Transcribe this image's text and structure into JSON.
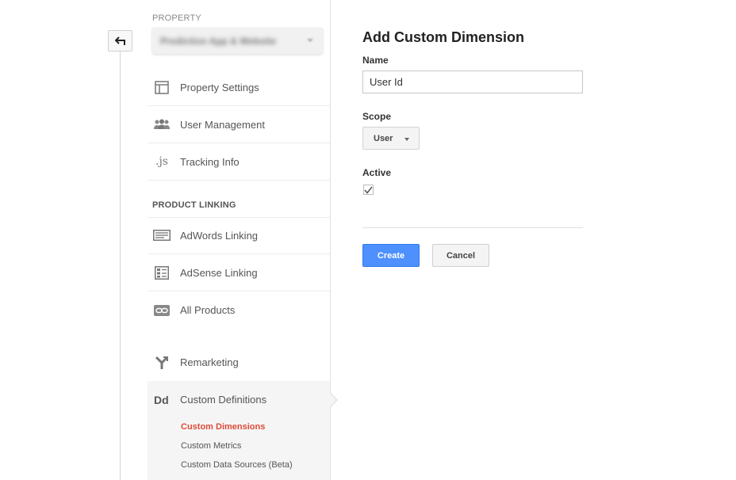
{
  "sidebar": {
    "property_label": "PROPERTY",
    "property_value": "Prediction App & Website",
    "items": [
      {
        "label": "Property Settings",
        "icon": "layout-icon"
      },
      {
        "label": "User Management",
        "icon": "users-icon"
      },
      {
        "label": "Tracking Info",
        "icon": "js-icon",
        "glyph": ".js"
      }
    ],
    "product_linking_label": "PRODUCT LINKING",
    "linking_items": [
      {
        "label": "AdWords Linking",
        "icon": "adwords-icon"
      },
      {
        "label": "AdSense Linking",
        "icon": "adsense-icon"
      },
      {
        "label": "All Products",
        "icon": "link-icon"
      }
    ],
    "remarketing": {
      "label": "Remarketing",
      "icon": "remarketing-icon"
    },
    "custom_definitions": {
      "label": "Custom Definitions",
      "glyph": "Dd",
      "sub_items": [
        {
          "label": "Custom Dimensions",
          "active": true
        },
        {
          "label": "Custom Metrics",
          "active": false
        },
        {
          "label": "Custom Data Sources (Beta)",
          "active": false
        }
      ]
    }
  },
  "form": {
    "title": "Add Custom Dimension",
    "name_label": "Name",
    "name_value": "User Id",
    "scope_label": "Scope",
    "scope_value": "User",
    "active_label": "Active",
    "active_checked": true,
    "create_label": "Create",
    "cancel_label": "Cancel"
  },
  "colors": {
    "accent_blue": "#4d90fe",
    "active_red": "#dd4b39"
  }
}
